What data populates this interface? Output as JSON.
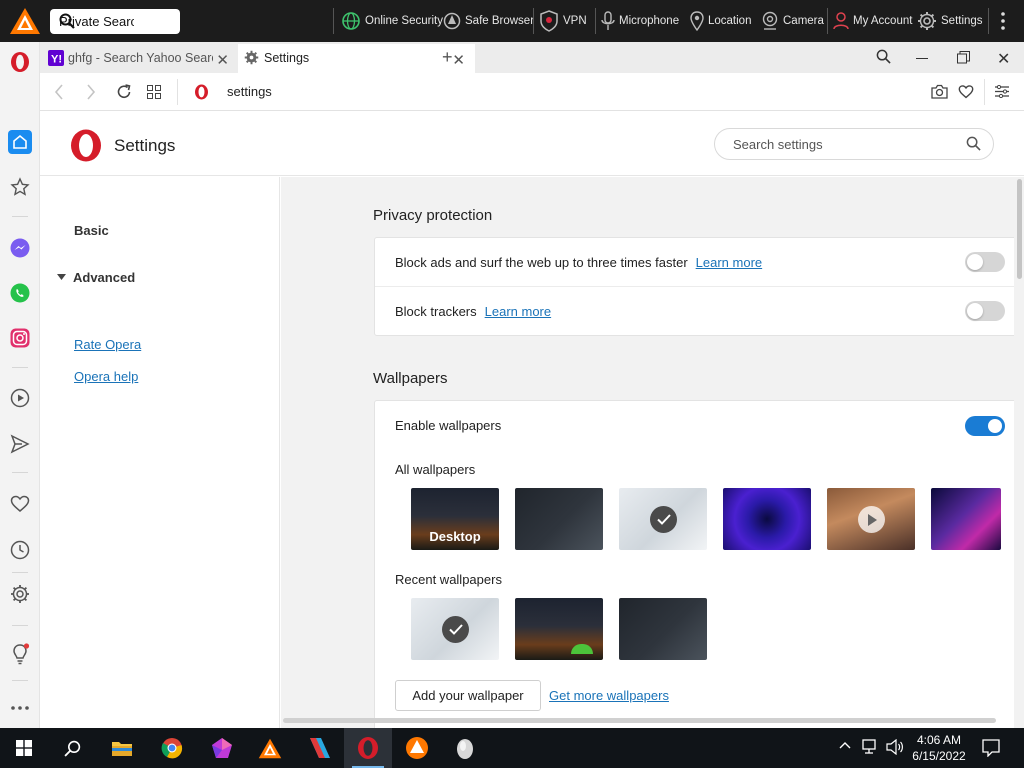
{
  "topbar": {
    "search_text": "Private Searc",
    "items": [
      "Online Security",
      "Safe Browser",
      "VPN",
      "Microphone",
      "Location",
      "Camera",
      "My Account",
      "Settings"
    ]
  },
  "tabs": [
    {
      "title": "ghfg - Search Yahoo Search",
      "active": false
    },
    {
      "title": "Settings",
      "active": true
    }
  ],
  "address": {
    "url": "settings"
  },
  "settings": {
    "title": "Settings",
    "search_placeholder": "Search settings"
  },
  "nav": {
    "basic": "Basic",
    "advanced": "Advanced",
    "rate": "Rate Opera",
    "help": "Opera help"
  },
  "privacy": {
    "heading": "Privacy protection",
    "block_ads": "Block ads and surf the web up to three times faster",
    "block_ads_link": "Learn more",
    "block_trackers": "Block trackers",
    "block_trackers_link": "Learn more",
    "block_ads_enabled": false,
    "block_trackers_enabled": false
  },
  "wallpapers": {
    "heading": "Wallpapers",
    "enable_label": "Enable wallpapers",
    "enabled": true,
    "all_label": "All wallpapers",
    "desktop_label": "Desktop",
    "recent_label": "Recent wallpapers",
    "add_button": "Add your wallpaper",
    "more_link": "Get more wallpapers"
  },
  "taskbar": {
    "time": "4:06 AM",
    "date": "6/15/2022"
  },
  "colors": {
    "accent": "#1a7cd4",
    "opera_red": "#d51d2a",
    "link": "#1a73b8",
    "topbar_bg": "#1c1c1c",
    "taskbar_bg": "#101418"
  }
}
